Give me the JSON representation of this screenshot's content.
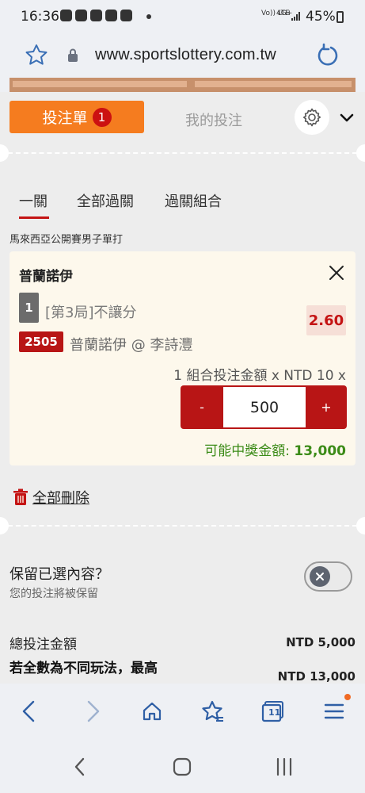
{
  "status_bar": {
    "time": "16:36",
    "network_top": "Vo)) LTE",
    "network_right": "4G+",
    "battery": "45%"
  },
  "browser": {
    "url": "www.sportslottery.com.tw"
  },
  "panel": {
    "bet_slip_tab": "投注單",
    "bet_slip_count": "1",
    "my_bets_tab": "我的投注",
    "sub_tabs": [
      "一關",
      "全部過關",
      "過關組合"
    ],
    "league": "馬來西亞公開賽男子單打"
  },
  "bet": {
    "player": "普蘭諾伊",
    "leg_number": "1",
    "market": "[第3局]不讓分",
    "odds": "2.60",
    "match_code": "2505",
    "match": "普蘭諾伊 @ 李詩灃",
    "combo_text": "1 組合投注金額 x NTD 10 x",
    "minus": "-",
    "plus": "+",
    "amount": "500",
    "win_label": "可能中獎金額:",
    "win_value": "13,000"
  },
  "delete_all": "全部刪除",
  "keep": {
    "title": "保留已選內容？",
    "subtitle": "您的投注將被保留",
    "enabled": false
  },
  "totals": {
    "total_label": "總投注金額",
    "total_value": "NTD 5,000",
    "max_label": "若全數為不同玩法，最高",
    "max_value": "NTD 13,000"
  },
  "toolbar": {
    "tabs_count": "11"
  },
  "colors": {
    "accent_orange": "#f57c1f",
    "brand_red": "#b81515",
    "win_green": "#3b8b17"
  }
}
